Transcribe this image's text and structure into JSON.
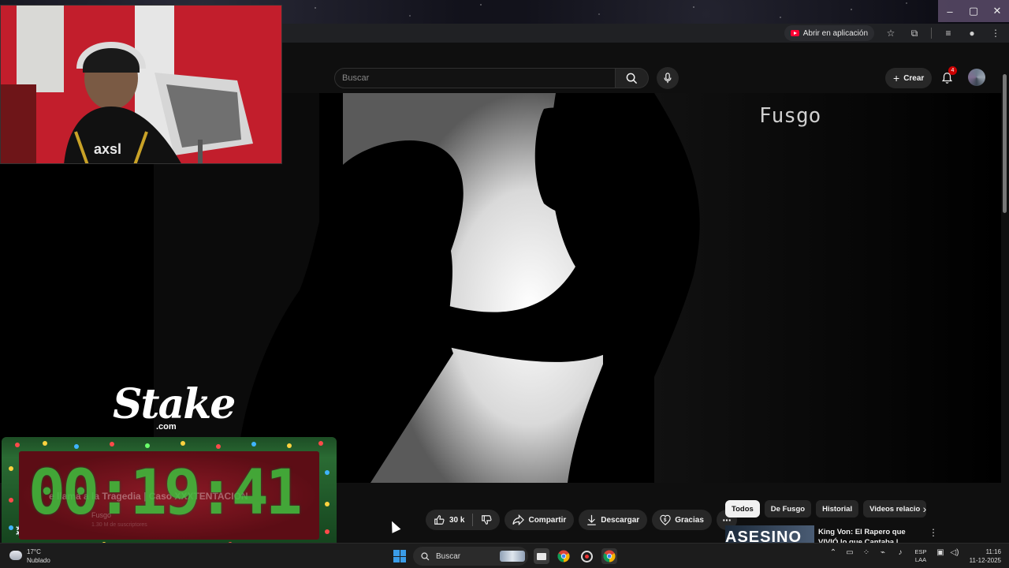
{
  "browser": {
    "open_in_app_label": "Abrir en aplicación"
  },
  "header": {
    "search_placeholder": "Buscar",
    "create_label": "Crear",
    "notification_count": "4"
  },
  "video": {
    "channel_watermark": "Fusgo"
  },
  "overlay": {
    "stake_brand": "Stake",
    "stake_domain": ".com",
    "timer_value": "00:19:41",
    "ghost_title": "e llama a la Tragedia | Caso XXXTENTACION",
    "ghost_channel": "Fusgo",
    "ghost_subscribers": "1.30 M de suscriptores"
  },
  "actions": {
    "like_count": "30 k",
    "share_label": "Compartir",
    "download_label": "Descargar",
    "thanks_label": "Gracias"
  },
  "chips": [
    {
      "label": "Todos",
      "active": true
    },
    {
      "label": "De Fusgo",
      "active": false
    },
    {
      "label": "Historial",
      "active": false
    },
    {
      "label": "Videos relacio",
      "active": false
    }
  ],
  "recommended": {
    "thumb_text": "ASESINO",
    "title": "King Von: El Rapero que VIVIÓ lo que Cantaba | Historia"
  },
  "taskbar": {
    "temperature": "17°C",
    "weather": "Nublado",
    "search_label": "Buscar",
    "lang_line1": "ESP",
    "lang_line2": "LAA",
    "time": "11:16",
    "date": "11-12-2025"
  }
}
